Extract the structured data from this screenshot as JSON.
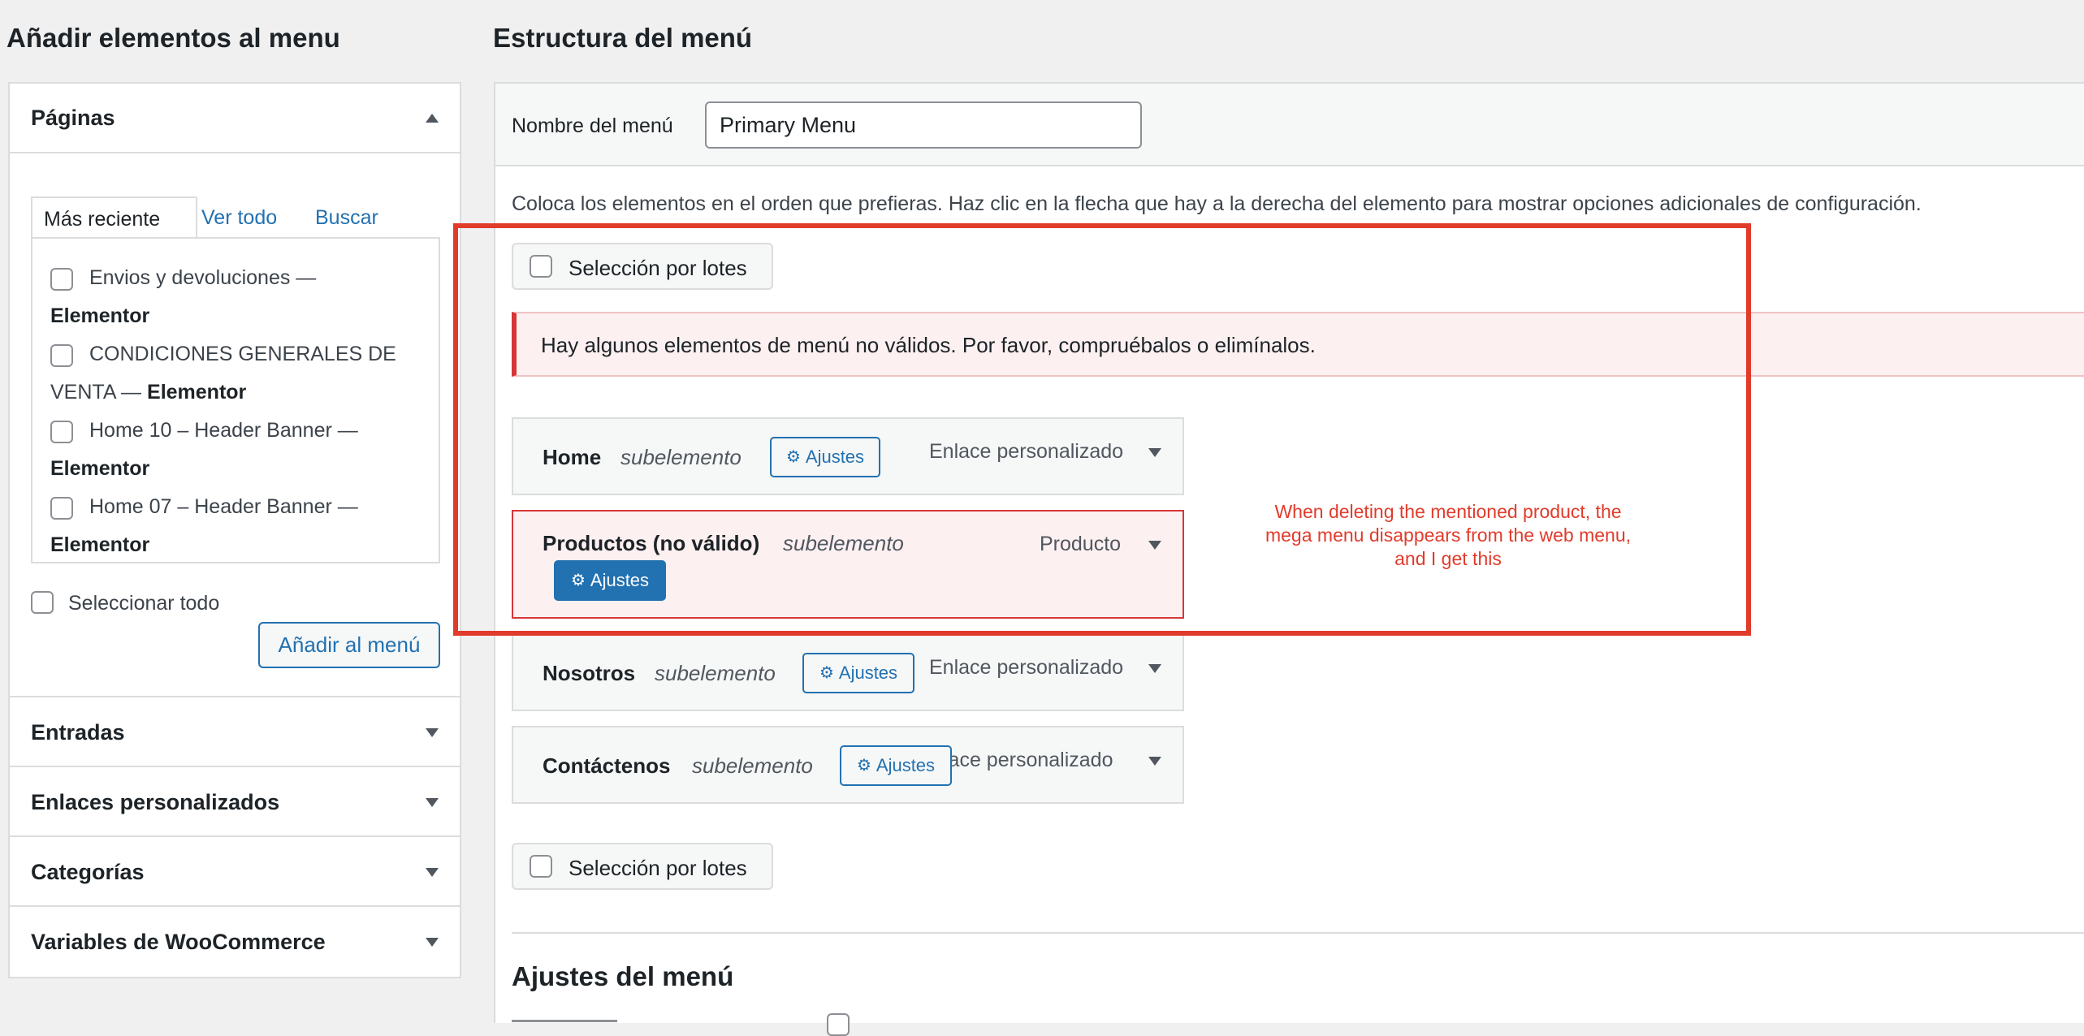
{
  "left": {
    "title": "Añadir elementos al menu",
    "pages": {
      "header": "Páginas",
      "tabs": [
        "Más reciente",
        "Ver todo",
        "Buscar"
      ],
      "items": [
        {
          "line1": "Envios y devoluciones —",
          "bold": "Elementor"
        },
        {
          "line1": "CONDICIONES GENERALES DE",
          "line2": "VENTA — ",
          "bold": "Elementor"
        },
        {
          "line1": "Home 10 – Header Banner —",
          "bold": "Elementor"
        },
        {
          "line1": "Home 07 – Header Banner —",
          "bold": "Elementor"
        }
      ],
      "select_all": "Seleccionar todo",
      "add_button": "Añadir al menú"
    },
    "sections": [
      "Entradas",
      "Enlaces personalizados",
      "Categorías",
      "Variables de WooCommerce"
    ]
  },
  "right": {
    "title": "Estructura del menú",
    "menu_name_label": "Nombre del menú",
    "menu_name_value": "Primary Menu",
    "instructions": "Coloca los elementos en el orden que prefieras. Haz clic en la flecha que hay a la derecha del elemento para mostrar opciones adicionales de configuración.",
    "batch_select": "Selección por lotes",
    "notice": "Hay algunos elementos de menú no válidos. Por favor, compruébalos o elimínalos.",
    "items": [
      {
        "title": "Home",
        "sub": "subelemento",
        "settings": "Ajustes",
        "type": "Enlace personalizado"
      },
      {
        "title": "Productos (no válido)",
        "sub": "subelemento",
        "settings": "Ajustes",
        "type": "Producto"
      },
      {
        "title": "Nosotros",
        "sub": "subelemento",
        "settings": "Ajustes",
        "type": "Enlace personalizado"
      },
      {
        "title": "Contáctenos",
        "sub": "subelemento",
        "settings": "Ajustes",
        "type": "lace personalizado"
      }
    ],
    "settings_title": "Ajustes del menú",
    "annotation": [
      "When deleting the mentioned product, the",
      "mega menu disappears from the web menu,",
      "and I get this"
    ]
  },
  "colors": {
    "annotation_red": "#e13b2b",
    "link_blue": "#2271b1",
    "error_bg": "#fcf0f1",
    "error_border": "#d63638"
  }
}
